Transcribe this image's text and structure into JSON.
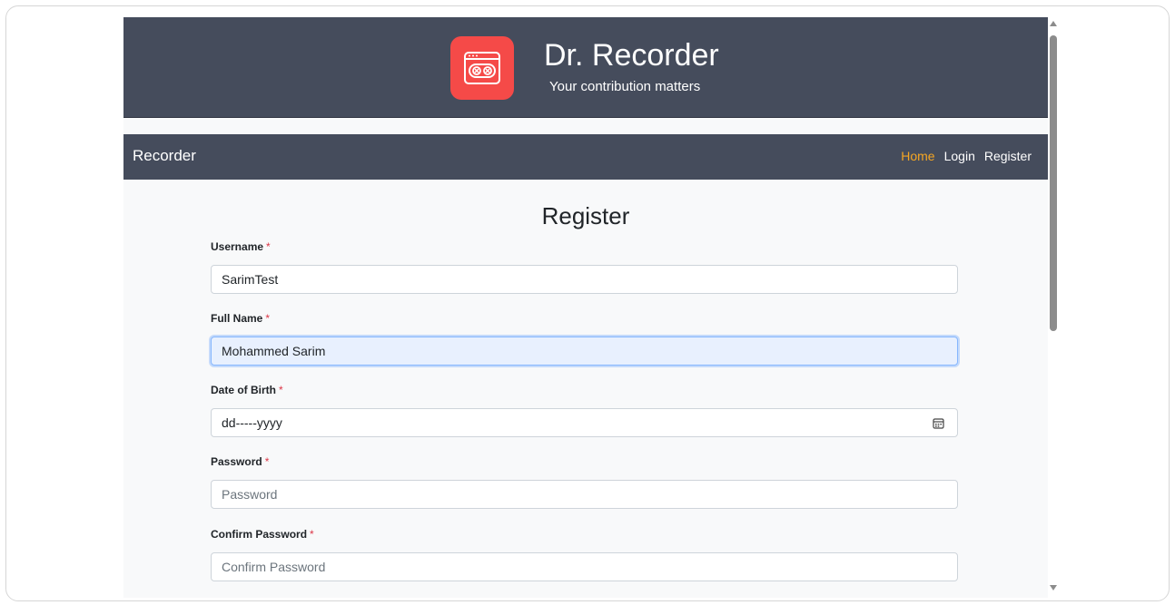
{
  "header": {
    "title": "Dr. Recorder",
    "subtitle": "Your contribution matters",
    "logo_color": "#f54a48"
  },
  "navbar": {
    "brand": "Recorder",
    "links": [
      "Home",
      "Login",
      "Register"
    ],
    "active_color": "#f5a623"
  },
  "form": {
    "title": "Register",
    "required_mark": "*",
    "username": {
      "label": "Username",
      "value": "SarimTest"
    },
    "full_name": {
      "label": "Full Name",
      "value": "Mohammed Sarim"
    },
    "dob": {
      "label": "Date of Birth",
      "placeholder": "dd-----yyyy"
    },
    "password": {
      "label": "Password",
      "placeholder": "Password"
    },
    "confirm_password": {
      "label": "Confirm Password",
      "placeholder": "Confirm Password"
    }
  }
}
